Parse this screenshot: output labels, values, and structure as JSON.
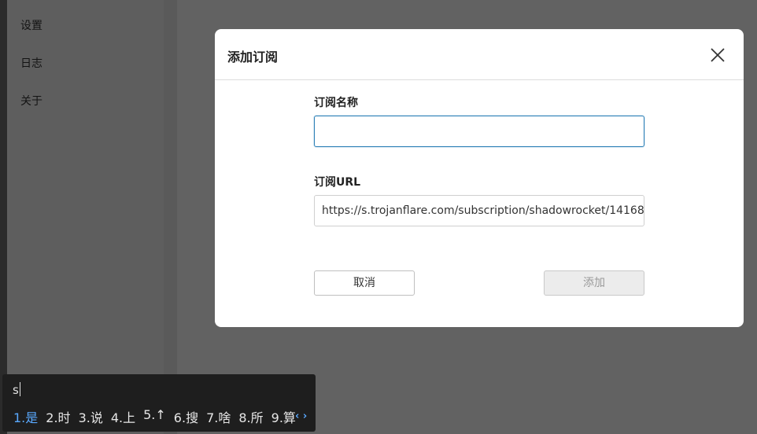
{
  "sidebar": {
    "items": [
      {
        "label": "设置"
      },
      {
        "label": "日志"
      },
      {
        "label": "关于"
      }
    ]
  },
  "dialog": {
    "title": "添加订阅",
    "close_icon": "close-icon",
    "name_field": {
      "label": "订阅名称",
      "value": "",
      "placeholder": ""
    },
    "url_field": {
      "label": "订阅URL",
      "value": "https://s.trojanflare.com/subscription/shadowrocket/14168..."
    },
    "cancel_label": "取消",
    "add_label": "添加"
  },
  "ime": {
    "input": "s",
    "candidates": [
      "1.是",
      "2.时",
      "3.说",
      "4.上",
      "5.↑",
      "6.搜",
      "7.啥",
      "8.所",
      "9.算"
    ],
    "selected_index": 0,
    "arrows": "‹ ›"
  },
  "colors": {
    "focus_border": "#2b7fb6",
    "ime_highlight": "#5aa9ff"
  }
}
